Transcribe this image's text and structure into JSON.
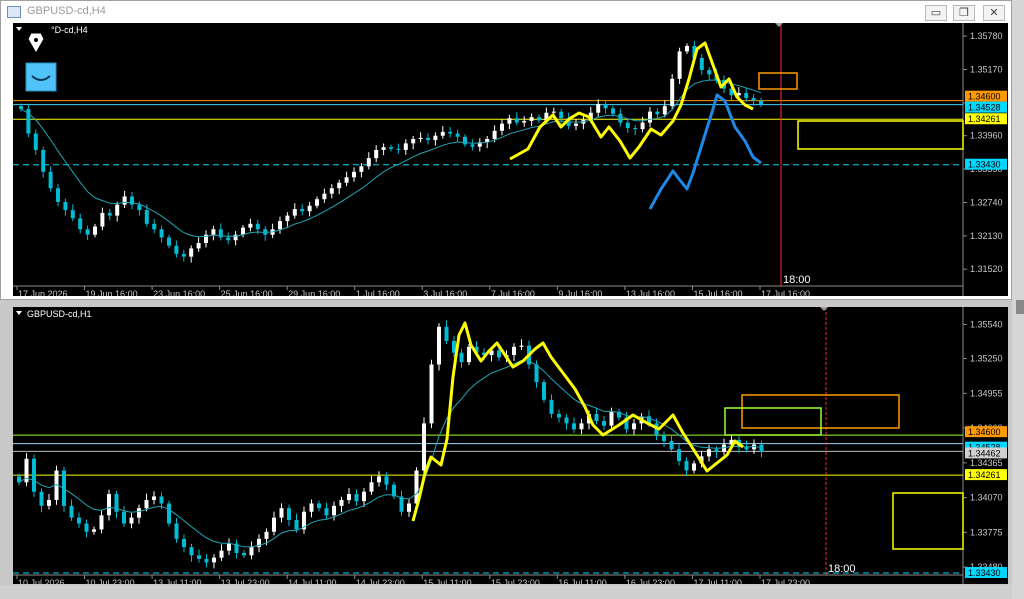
{
  "window": {
    "title": "GBPUSD-cd,H4",
    "buttons": {
      "minimize": "▭",
      "restore": "❐",
      "close": "✕"
    }
  },
  "colors": {
    "background": "#000000",
    "bull_candle": "#ffffff",
    "bear_candle": "#00bcd4",
    "moving_average": "#1fa6b5",
    "drawing_yellow": "#ffff00",
    "drawing_blue": "#1e88e5",
    "time_line": "#ff2a2a",
    "axis_text": "#c8c8c8"
  },
  "icons": {
    "top_left": "pen-nib-icon",
    "indicator": "smile-icon"
  },
  "chart_data": [
    {
      "type": "candlestick",
      "symbol_label": "°D-cd,H4",
      "timeframe": "H4",
      "ylim": [
        1.3125,
        1.3591
      ],
      "y_ticks": [
        "1.35780",
        "1.35170",
        "1.34560",
        "1.33960",
        "1.33350",
        "1.32740",
        "1.32130",
        "1.31520"
      ],
      "x_ticks": [
        "17 Jun 2026",
        "19 Jun 16:00",
        "23 Jun 16:00",
        "25 Jun 16:00",
        "29 Jun 16:00",
        "1 Jul 16:00",
        "3 Jul 16:00",
        "7 Jul 16:00",
        "9 Jul 16:00",
        "13 Jul 16:00",
        "15 Jul 16:00",
        "17 Jul 16:00"
      ],
      "price_labels": [
        {
          "text": "1.34600",
          "value": 1.346,
          "bg": "#ff9900"
        },
        {
          "text": "1.34528",
          "value": 1.34528,
          "bg": "#00d8ff"
        },
        {
          "text": "1.34261",
          "value": 1.34261,
          "bg": "#ffff00"
        },
        {
          "text": "1.33430",
          "value": 1.3343,
          "bg": "#00d8ff"
        }
      ],
      "horizontal_lines": [
        {
          "value": 1.346,
          "color": "#ff9900",
          "style": "solid"
        },
        {
          "value": 1.34528,
          "color": "#3fd4ff",
          "style": "solid"
        },
        {
          "value": 1.34261,
          "color": "#ffff00",
          "style": "solid"
        },
        {
          "value": 1.3343,
          "color": "#00d8ff",
          "style": "dashed"
        }
      ],
      "vline_label": "18:00",
      "close_series": [
        1.3445,
        1.34,
        1.337,
        1.333,
        1.33,
        1.3275,
        1.326,
        1.3245,
        1.3225,
        1.3215,
        1.323,
        1.3255,
        1.325,
        1.327,
        1.3285,
        1.327,
        1.326,
        1.3235,
        1.3225,
        1.321,
        1.3195,
        1.318,
        1.3175,
        1.319,
        1.32,
        1.3215,
        1.3225,
        1.321,
        1.3205,
        1.3215,
        1.3228,
        1.3235,
        1.3225,
        1.3215,
        1.3225,
        1.324,
        1.325,
        1.3262,
        1.3258,
        1.3268,
        1.328,
        1.329,
        1.33,
        1.331,
        1.332,
        1.333,
        1.334,
        1.3355,
        1.337,
        1.3375,
        1.3372,
        1.337,
        1.3382,
        1.339,
        1.3392,
        1.3388,
        1.3396,
        1.3403,
        1.34,
        1.3394,
        1.338,
        1.3376,
        1.3384,
        1.339,
        1.3405,
        1.3418,
        1.3428,
        1.342,
        1.3423,
        1.343,
        1.3424,
        1.3438,
        1.344,
        1.3428,
        1.3414,
        1.3418,
        1.3425,
        1.3438,
        1.3454,
        1.3446,
        1.3436,
        1.342,
        1.341,
        1.3408,
        1.342,
        1.344,
        1.3435,
        1.345,
        1.35,
        1.355,
        1.356,
        1.3538,
        1.3516,
        1.3508,
        1.3498,
        1.3482,
        1.347,
        1.3474,
        1.3465,
        1.346,
        1.3453
      ],
      "series": [
        {
          "name": "yellow zigzag",
          "color": "#ffff00",
          "points": [
            [
              0.0,
              0.0
            ]
          ]
        },
        {
          "name": "blue path",
          "color": "#1e88e5",
          "points": [
            [
              0.0,
              0.0
            ]
          ]
        }
      ]
    },
    {
      "type": "candlestick",
      "symbol_label": "GBPUSD-cd,H1",
      "timeframe": "H1",
      "ylim": [
        1.3343,
        1.3562
      ],
      "y_ticks": [
        "1.35540",
        "1.35250",
        "1.34955",
        "1.34660",
        "1.34365",
        "1.34070",
        "1.33775",
        "1.33480"
      ],
      "x_ticks": [
        "10 Jul 2026",
        "10 Jul 23:00",
        "13 Jul 11:00",
        "13 Jul 23:00",
        "14 Jul 11:00",
        "14 Jul 23:00",
        "15 Jul 11:00",
        "15 Jul 23:00",
        "16 Jul 11:00",
        "16 Jul 23:00",
        "17 Jul 11:00",
        "17 Jul 23:00"
      ],
      "price_labels": [
        {
          "text": "1.34600",
          "value": 1.346,
          "bg": "#ff9900"
        },
        {
          "text": "1.34528",
          "value": 1.34528,
          "bg": "#00d8ff"
        },
        {
          "text": "1.34462",
          "value": 1.34462,
          "bg": "#d0d0d0"
        },
        {
          "text": "1.34261",
          "value": 1.34261,
          "bg": "#ffff00"
        },
        {
          "text": "1.33430",
          "value": 1.3343,
          "bg": "#00d8ff"
        }
      ],
      "horizontal_lines": [
        {
          "value": 1.346,
          "color": "#9cff2e",
          "style": "solid"
        },
        {
          "value": 1.34528,
          "color": "#9ad8ff",
          "style": "solid"
        },
        {
          "value": 1.34462,
          "color": "#bbbbbb",
          "style": "solid"
        },
        {
          "value": 1.34261,
          "color": "#ffff00",
          "style": "solid"
        },
        {
          "value": 1.3343,
          "color": "#00d8ff",
          "style": "dashed"
        }
      ],
      "vline_label": "18:00",
      "close_series": [
        1.342,
        1.344,
        1.3412,
        1.34,
        1.3405,
        1.343,
        1.34,
        1.339,
        1.3385,
        1.3378,
        1.338,
        1.3392,
        1.341,
        1.3395,
        1.3385,
        1.339,
        1.3398,
        1.3405,
        1.3408,
        1.3402,
        1.3385,
        1.3372,
        1.3365,
        1.3358,
        1.3355,
        1.3352,
        1.3356,
        1.3362,
        1.3368,
        1.336,
        1.3358,
        1.3365,
        1.3372,
        1.3378,
        1.339,
        1.3398,
        1.3388,
        1.338,
        1.3395,
        1.3402,
        1.3398,
        1.3392,
        1.34,
        1.3405,
        1.341,
        1.3404,
        1.3412,
        1.342,
        1.3425,
        1.3418,
        1.3408,
        1.3395,
        1.3402,
        1.343,
        1.347,
        1.352,
        1.3552,
        1.354,
        1.353,
        1.3522,
        1.3535,
        1.353,
        1.3528,
        1.3532,
        1.3526,
        1.3528,
        1.3535,
        1.3536,
        1.352,
        1.3505,
        1.349,
        1.3478,
        1.3475,
        1.347,
        1.3465,
        1.347,
        1.3478,
        1.3472,
        1.3468,
        1.348,
        1.3475,
        1.3465,
        1.347,
        1.3476,
        1.347,
        1.346,
        1.3455,
        1.3448,
        1.3438,
        1.343,
        1.3436,
        1.3442,
        1.3448,
        1.3446,
        1.3452,
        1.3456,
        1.345,
        1.3448,
        1.3452,
        1.3446
      ]
    }
  ]
}
